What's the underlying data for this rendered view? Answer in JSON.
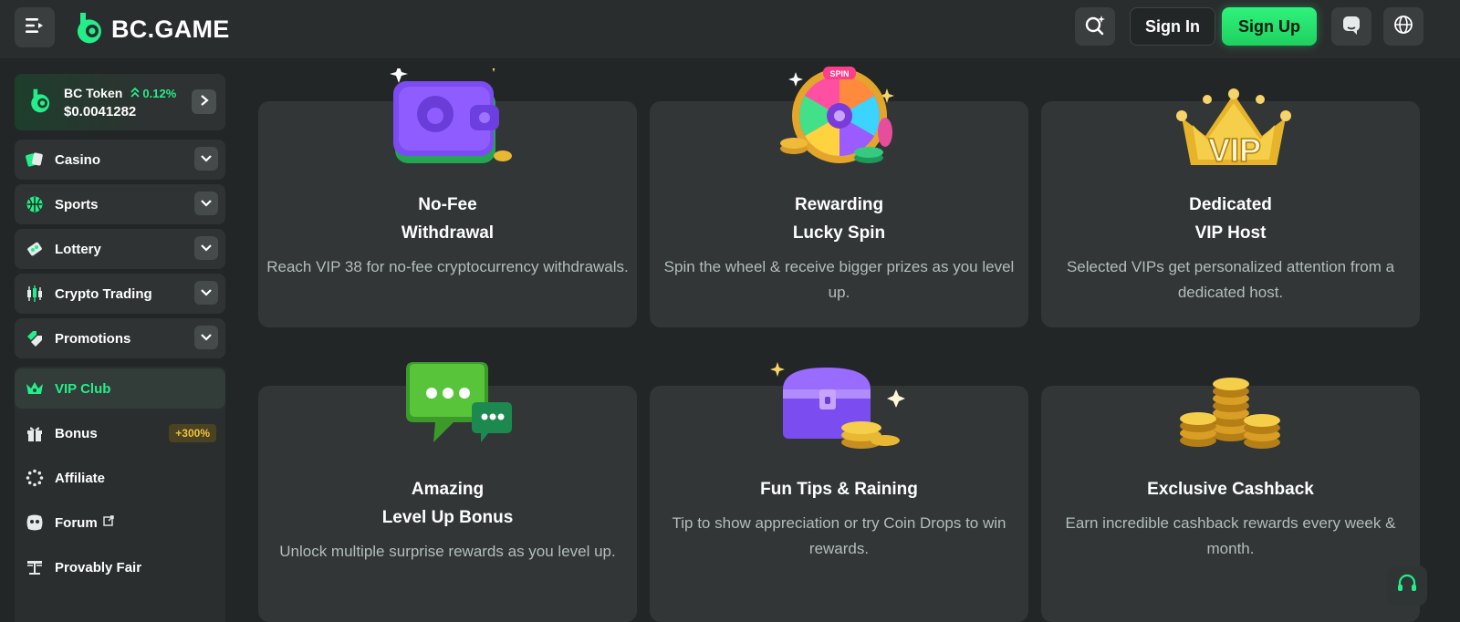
{
  "header": {
    "logo_text": "BC.GAME",
    "signin_label": "Sign In",
    "signup_label": "Sign Up",
    "icons": [
      "menu-icon",
      "search-sparkle-icon",
      "chat-icon",
      "globe-icon"
    ]
  },
  "sidebar": {
    "token": {
      "name": "BC Token",
      "change": "0.12%",
      "price": "$0.0041282"
    },
    "groups": [
      {
        "label": "Casino",
        "icon": "cards-icon"
      },
      {
        "label": "Sports",
        "icon": "basketball-icon"
      },
      {
        "label": "Lottery",
        "icon": "ticket-icon"
      },
      {
        "label": "Crypto Trading",
        "icon": "candlestick-icon"
      },
      {
        "label": "Promotions",
        "icon": "tags-icon"
      }
    ],
    "links": [
      {
        "label": "VIP Club",
        "icon": "crown-icon",
        "active": true
      },
      {
        "label": "Bonus",
        "icon": "gift-icon",
        "badge": "+300%"
      },
      {
        "label": "Affiliate",
        "icon": "affiliate-ring-icon"
      },
      {
        "label": "Forum",
        "icon": "forum-icon"
      },
      {
        "label": "Provably Fair",
        "icon": "balance-icon"
      }
    ]
  },
  "cards": [
    {
      "title1": "No-Fee",
      "title2": "Withdrawal",
      "desc": "Reach VIP 38 for no-fee cryptocurrency withdrawals.",
      "image": "wallet-illustration"
    },
    {
      "title1": "Rewarding",
      "title2": "Lucky Spin",
      "desc": "Spin the wheel & receive bigger prizes as you level up.",
      "image": "spin-wheel-illustration"
    },
    {
      "title1": "Dedicated",
      "title2": "VIP Host",
      "desc": "Selected VIPs get personalized attention from a dedicated host.",
      "image": "vip-crown-illustration"
    },
    {
      "title1": "Amazing",
      "title2": "Level Up Bonus",
      "desc": "Unlock multiple surprise rewards as you level up.",
      "image": "chat-bubbles-illustration"
    },
    {
      "title1": "Fun Tips & Raining",
      "title2": "",
      "desc": "Tip to show appreciation or try Coin Drops to win rewards.",
      "image": "treasure-chest-illustration"
    },
    {
      "title1": "Exclusive Cashback",
      "title2": "",
      "desc": "Earn incredible cashback rewards every week & month.",
      "image": "coin-stacks-illustration"
    }
  ],
  "vip_badge_text": "VIP",
  "spin_badge_text": "SPIN",
  "colors": {
    "accent": "#24ee89",
    "bg": "#232626",
    "card": "#323636",
    "badge": "#f0c33b"
  }
}
